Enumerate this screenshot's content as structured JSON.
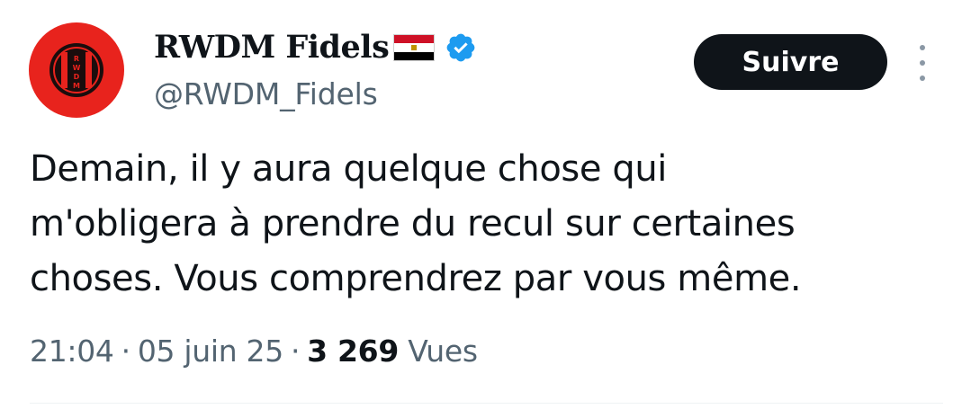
{
  "author": {
    "name": "RWDM Fidels",
    "handle": "@RWDM_Fidels",
    "flag_icon": "egypt-flag-icon",
    "verified_icon": "verified-badge-icon",
    "verified_color": "#1d9bf0",
    "avatar": {
      "icon": "rwdm-club-logo",
      "background": "#e8231d",
      "letters": [
        "R",
        "W",
        "D",
        "M"
      ]
    }
  },
  "follow_button": {
    "label": "Suivre"
  },
  "more_icon": "more-options-icon",
  "tweet": {
    "text_lines": [
      "Demain, il y aura quelque chose qui",
      "m'obligera à prendre du recul sur certaines",
      "choses. Vous comprendrez par vous même."
    ]
  },
  "meta": {
    "time": "21:04",
    "separator": "·",
    "date": "05 juin 25",
    "views_count": "3 269",
    "views_label": "Vues"
  }
}
